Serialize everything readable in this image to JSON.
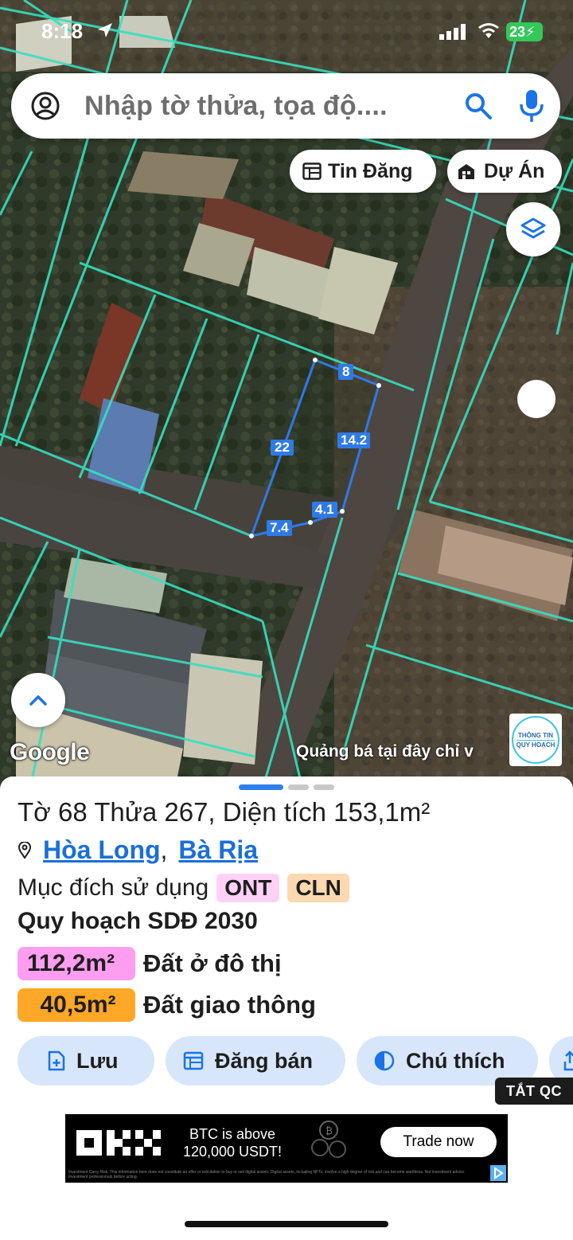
{
  "status_bar": {
    "time": "8:18",
    "battery": "23"
  },
  "search": {
    "placeholder": "Nhập tờ thửa, tọa độ...."
  },
  "map_buttons": {
    "tin_dang": "Tin Đăng",
    "du_an": "Dự Án"
  },
  "map": {
    "attribution": "Google",
    "ad_text": "Quảng bá tại đây chỉ v",
    "badge_line1": "THÔNG TIN",
    "badge_line2": "QUY HOẠCH",
    "dimensions": {
      "top": "8",
      "right": "14.2",
      "left": "22",
      "bottom_right": "4.1",
      "bottom": "7.4"
    }
  },
  "parcel": {
    "title": "Tờ 68 Thửa 267, Diện tích 153,1m²",
    "ward": "Hòa Long",
    "separator": ",",
    "district": "Bà Rịa",
    "purpose_label": "Mục đích sử dụng",
    "purpose_tags": [
      "ONT",
      "CLN"
    ],
    "plan_label": "Quy hoạch SDĐ 2030",
    "zones": [
      {
        "area": "112,2m²",
        "label": "Đất ở đô thị",
        "color": "#ff9df0"
      },
      {
        "area": "40,5m²",
        "label": "Đất giao thông",
        "color": "#ffa726"
      }
    ]
  },
  "actions": {
    "save": "Lưu",
    "post": "Đăng bán",
    "legend": "Chú thích"
  },
  "ads": {
    "hide_label": "TẮT QC",
    "banner_text_1": "BTC is above",
    "banner_text_2": "120,000 USDT!",
    "banner_cta": "Trade now",
    "banner_fine": "Investment Carry Risk. This information here does not constitute an offer or solicitation to buy or sell digital assets. Digital assets, including NFTs, involve a high degree of risk and can become worthless. Not investment advice. Investment professionals before acting."
  },
  "colors": {
    "parcel_line": "#35e0c0",
    "accent": "#2f80e8",
    "selected_plot": "#2f7ae8"
  }
}
